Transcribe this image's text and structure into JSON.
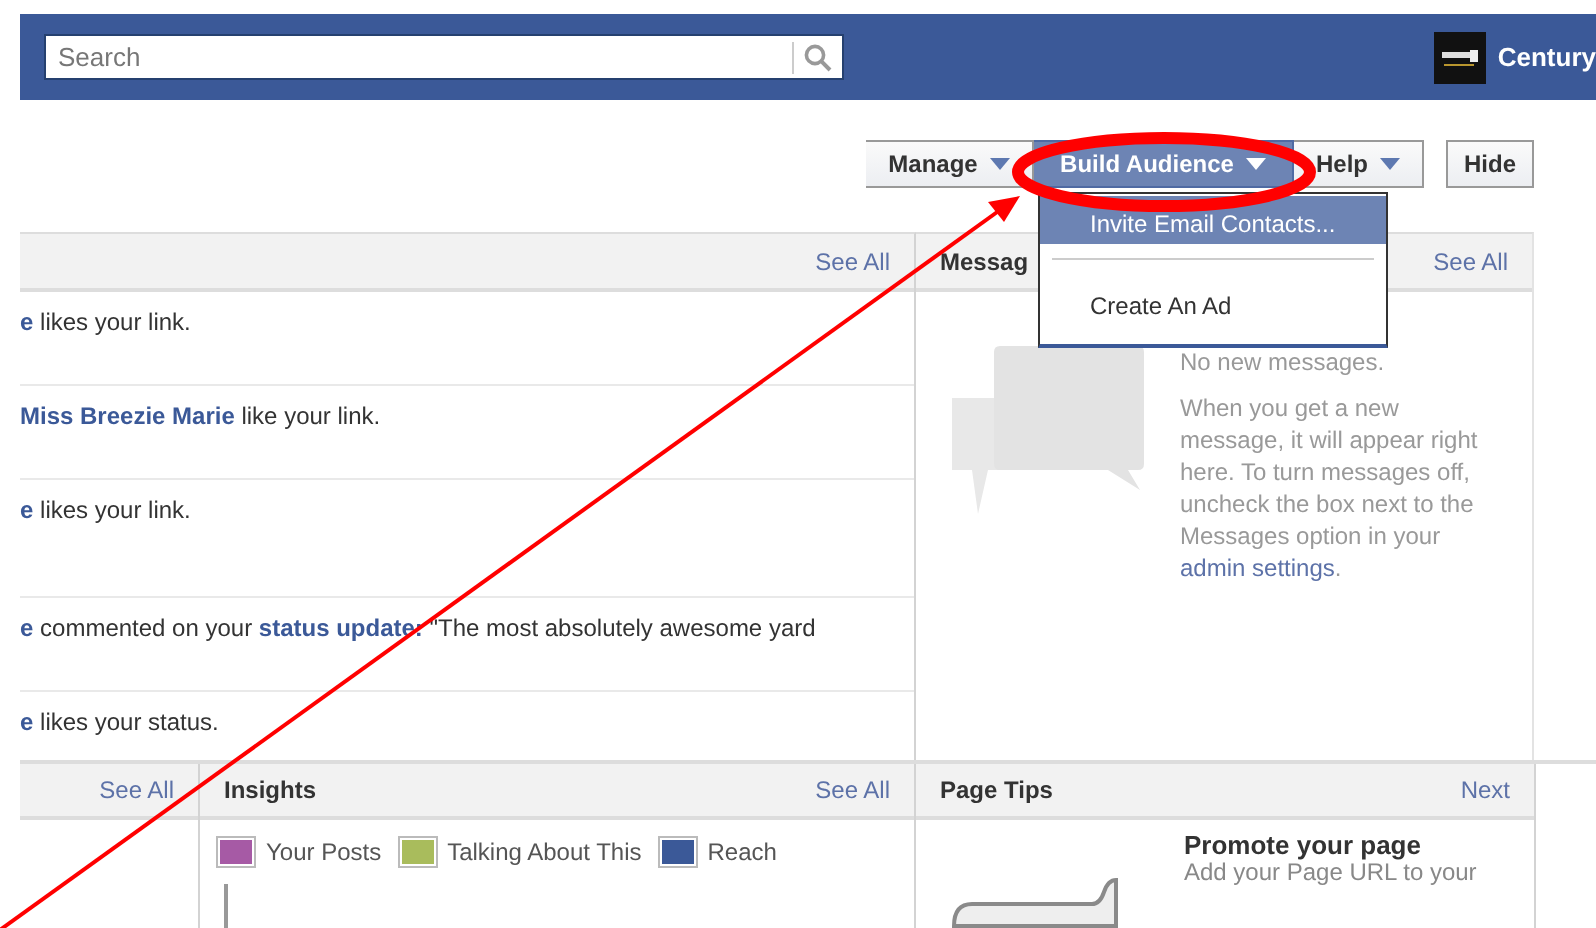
{
  "search": {
    "placeholder": "Search"
  },
  "account": {
    "name": "Century"
  },
  "toolbar": [
    {
      "label": "Manage",
      "kind": "menu",
      "selected": false
    },
    {
      "label": "Build Audience",
      "kind": "menu",
      "selected": true
    },
    {
      "label": "Help",
      "kind": "menu",
      "selected": false
    },
    {
      "label": "Hide",
      "kind": "button",
      "selected": false
    }
  ],
  "dropdown_menu": [
    {
      "label": "Invite Email Contacts...",
      "selected": true
    },
    {
      "label": "Create An Ad",
      "selected": false
    }
  ],
  "notifications": {
    "see_all": "See All",
    "items": [
      {
        "text": "**e** likes your link."
      },
      {
        "text": "**Miss Breezie Marie** like your link."
      },
      {
        "text": "**e** likes your link."
      },
      {
        "text": "**e** commented on your **status update:** \"The most absolutely awesome yard"
      },
      {
        "text": "**e** likes your status."
      }
    ]
  },
  "messages": {
    "title": "Messag",
    "see_all": "See All",
    "empty": "No new messages.",
    "body": "When you get a new message, it will appear right here. To turn messages off, uncheck the box next to the Messages option in your",
    "link": "admin settings",
    "body_end": "."
  },
  "bottom_left": {
    "see_all": "See All"
  },
  "insights": {
    "title": "Insights",
    "see_all": "See All",
    "legend": [
      {
        "label": "Your Posts",
        "color": "#a65aa5"
      },
      {
        "label": "Talking About This",
        "color": "#a9bc5c"
      },
      {
        "label": "Reach",
        "color": "#3b5998"
      }
    ]
  },
  "page_tips": {
    "title": "Page Tips",
    "next": "Next",
    "tip_title": "Promote your page",
    "tip_text": "Add your Page URL to your"
  }
}
